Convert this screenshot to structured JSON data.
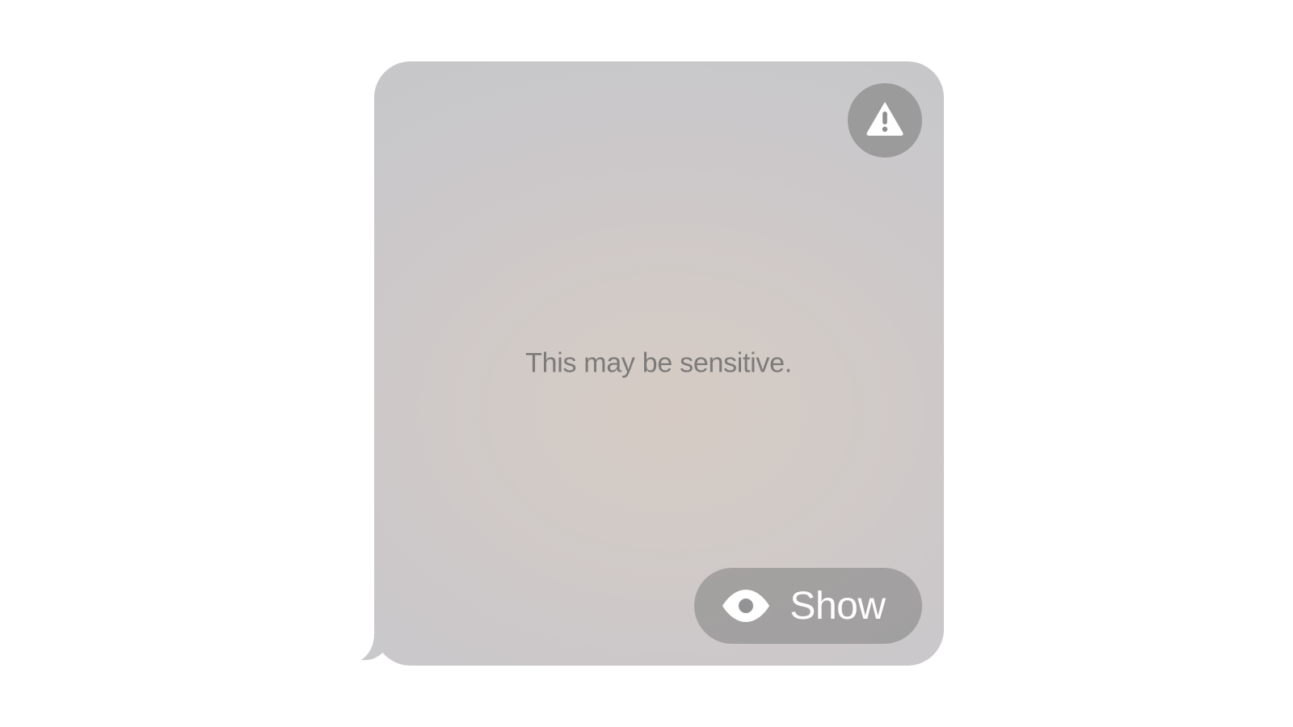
{
  "content_warning": {
    "message": "This may be sensitive.",
    "show_button_label": "Show"
  }
}
